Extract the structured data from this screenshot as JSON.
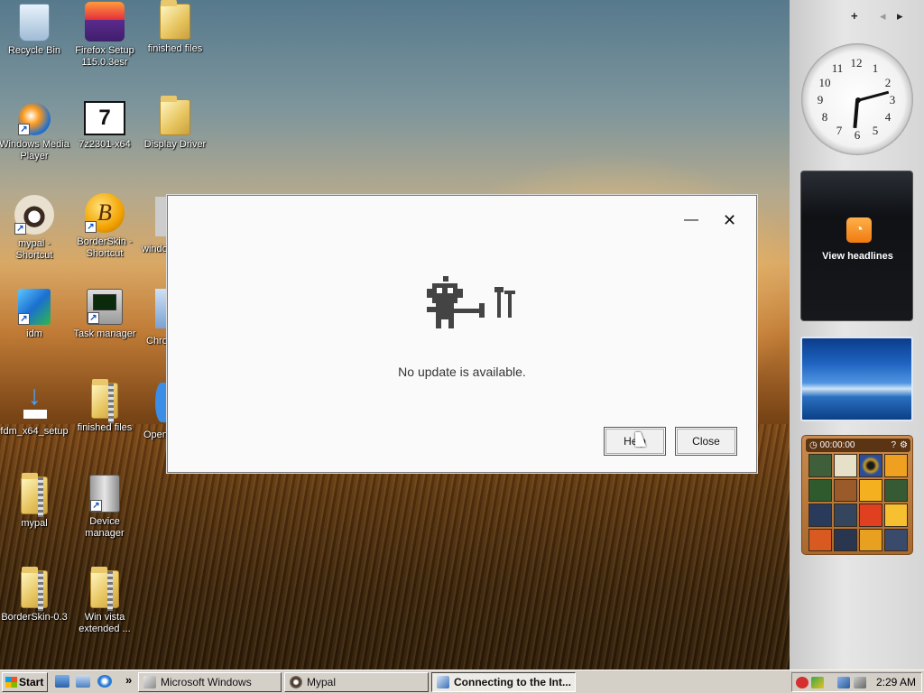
{
  "desktop": {
    "icons": [
      {
        "label": "Recycle Bin",
        "icon": "recycle-bin-icon"
      },
      {
        "label": "Firefox Setup 115.0.3esr",
        "icon": "firefox-installer-icon"
      },
      {
        "label": "finished files",
        "icon": "folder-icon"
      },
      {
        "label": "Windows Media Player",
        "icon": "media-player-icon"
      },
      {
        "label": "7z2301-x64",
        "icon": "7zip-icon"
      },
      {
        "label": "Display Driver",
        "icon": "folder-icon"
      },
      {
        "label": "mypal - Shortcut",
        "icon": "mypal-icon"
      },
      {
        "label": "BorderSkin - Shortcut",
        "icon": "borderskin-icon"
      },
      {
        "label": "windo",
        "icon": "app-icon"
      },
      {
        "label": "idm",
        "icon": "idm-icon"
      },
      {
        "label": "Task manager",
        "icon": "task-manager-icon"
      },
      {
        "label": "Chro",
        "icon": "chrome-icon"
      },
      {
        "label": "fdm_x64_setup",
        "icon": "download-icon"
      },
      {
        "label": "finished files",
        "icon": "zip-folder-icon"
      },
      {
        "label": "Open",
        "icon": "app-icon"
      },
      {
        "label": "mypal",
        "icon": "zip-folder-icon"
      },
      {
        "label": "Device manager",
        "icon": "device-manager-icon"
      },
      {
        "label": "BorderSkin-0.3",
        "icon": "zip-folder-icon"
      },
      {
        "label": "Win vista extended ...",
        "icon": "zip-folder-icon"
      }
    ]
  },
  "sidebar": {
    "add_label": "+",
    "prev_label": "◂",
    "next_label": "▸",
    "clock": {
      "numbers": [
        "12",
        "1",
        "2",
        "3",
        "4",
        "5",
        "6",
        "7",
        "8",
        "9",
        "10",
        "11"
      ]
    },
    "news": {
      "label": "View headlines"
    },
    "puzzle": {
      "timer": "00:00:00",
      "help": "?"
    }
  },
  "dialog": {
    "minimize_label": "—",
    "close_x_label": "✕",
    "message": "No update is available.",
    "help_label": "Help",
    "close_label": "Close"
  },
  "taskbar": {
    "start_label": "Start",
    "tasks": [
      {
        "label": "Microsoft Windows",
        "active": false
      },
      {
        "label": "Mypal",
        "active": false
      },
      {
        "label": "Connecting to the Int...",
        "active": true
      }
    ],
    "overflow_label": "»",
    "time": "2:29 AM"
  },
  "colors": {
    "taskbar": "#d4d0c8",
    "dialog_bg": "#fafafa",
    "rss_orange": "#f07a10"
  }
}
